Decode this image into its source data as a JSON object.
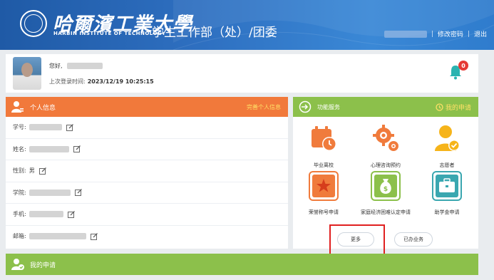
{
  "header": {
    "logo_cn": "哈爾濱工業大學",
    "logo_en": "HARBIN INSTITUTE OF TECHNOLOGY",
    "system_title": "学生工作部（处）/团委",
    "links": [
      "修改密码",
      "退出"
    ]
  },
  "user": {
    "greeting": "您好,",
    "last_login_label": "上次登录时间:",
    "last_login_time": "2023/12/19 10:25:15",
    "notifications": "0"
  },
  "personal_info": {
    "title": "个人信息",
    "complete_link": "完善个人信息",
    "fields": [
      {
        "label": "学号:"
      },
      {
        "label": "姓名:"
      },
      {
        "label": "性别:",
        "value": "男"
      },
      {
        "label": "学院:"
      },
      {
        "label": "手机:"
      },
      {
        "label": "邮箱:"
      }
    ]
  },
  "services": {
    "title": "功能服务",
    "my_apply": "我的申请",
    "items": [
      {
        "label": "毕业离校",
        "icon": "calendar-clock-icon"
      },
      {
        "label": "心理咨询预约",
        "icon": "gears-icon"
      },
      {
        "label": "志愿者",
        "icon": "volunteer-icon"
      },
      {
        "label": "荣誉称号申请",
        "icon": "honor-star-icon"
      },
      {
        "label": "家庭经济困难认定申请",
        "icon": "money-bag-icon"
      },
      {
        "label": "助学金申请",
        "icon": "briefcase-icon"
      }
    ],
    "more_button": "更多",
    "done_button": "已办业务"
  },
  "bottom": {
    "title": "我的申请"
  },
  "colors": {
    "header_blue": "#2e6fc0",
    "orange": "#f1793b",
    "green": "#8cc04b",
    "badge_red": "#e53935",
    "highlight_red": "#e02020"
  }
}
